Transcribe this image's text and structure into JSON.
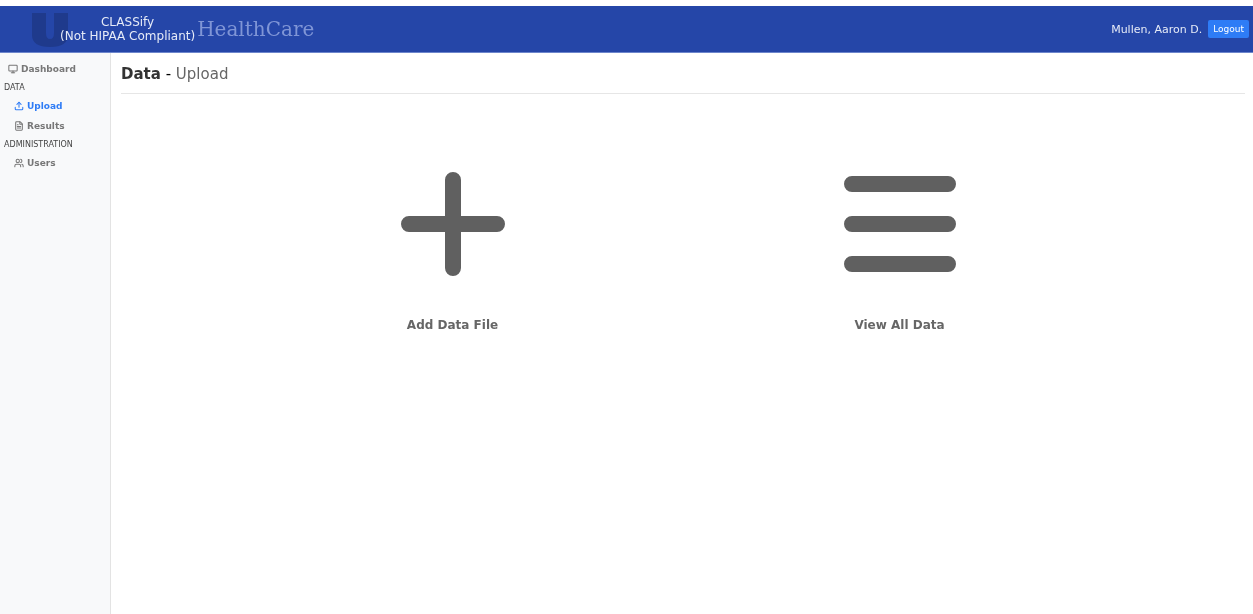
{
  "header": {
    "logo_text": "HealthCare",
    "title": "CLASSify",
    "subtitle": "(Not HIPAA Compliant)",
    "user": "Mullen, Aaron D.",
    "logout": "Logout"
  },
  "sidebar": {
    "items": [
      {
        "kind": "link",
        "label": "Dashboard",
        "selected": false
      },
      {
        "kind": "heading",
        "label": "DATA"
      },
      {
        "kind": "link",
        "label": "Upload",
        "selected": true
      },
      {
        "kind": "link",
        "label": "Results",
        "selected": false
      },
      {
        "kind": "heading",
        "label": "ADMINISTRATION"
      },
      {
        "kind": "link",
        "label": "Users",
        "selected": false
      }
    ]
  },
  "page": {
    "title": "Data",
    "separator": "-",
    "subtitle": "Upload"
  },
  "actions": [
    {
      "label": "Add Data File"
    },
    {
      "label": "View All Data"
    }
  ]
}
